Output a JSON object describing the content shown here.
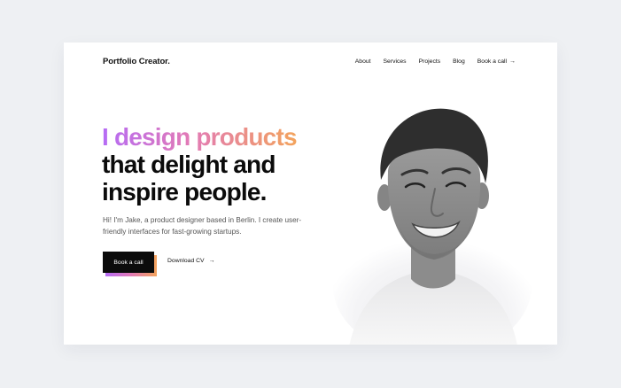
{
  "brand": {
    "logo": "Portfolio Creator."
  },
  "nav": {
    "items": [
      "About",
      "Services",
      "Projects",
      "Blog"
    ],
    "cta": "Book a call",
    "cta_icon": "arrow-right-icon"
  },
  "hero": {
    "headline_line1": "I design products",
    "headline_line2": "that delight and",
    "headline_line3": "inspire people.",
    "subtext": "Hi! I'm Jake, a product designer based in Berlin. I create user-friendly interfaces for fast-growing startups.",
    "primary_button": "Book a call",
    "secondary_button": "Download CV",
    "secondary_icon": "arrow-right-icon"
  },
  "image": {
    "subject": "portrait-photo"
  },
  "colors": {
    "gradient_start": "#b56cf5",
    "gradient_mid": "#e27ab6",
    "gradient_end": "#f3a35c",
    "text": "#0b0b0b",
    "page_bg": "#eef0f3",
    "card_bg": "#ffffff"
  }
}
